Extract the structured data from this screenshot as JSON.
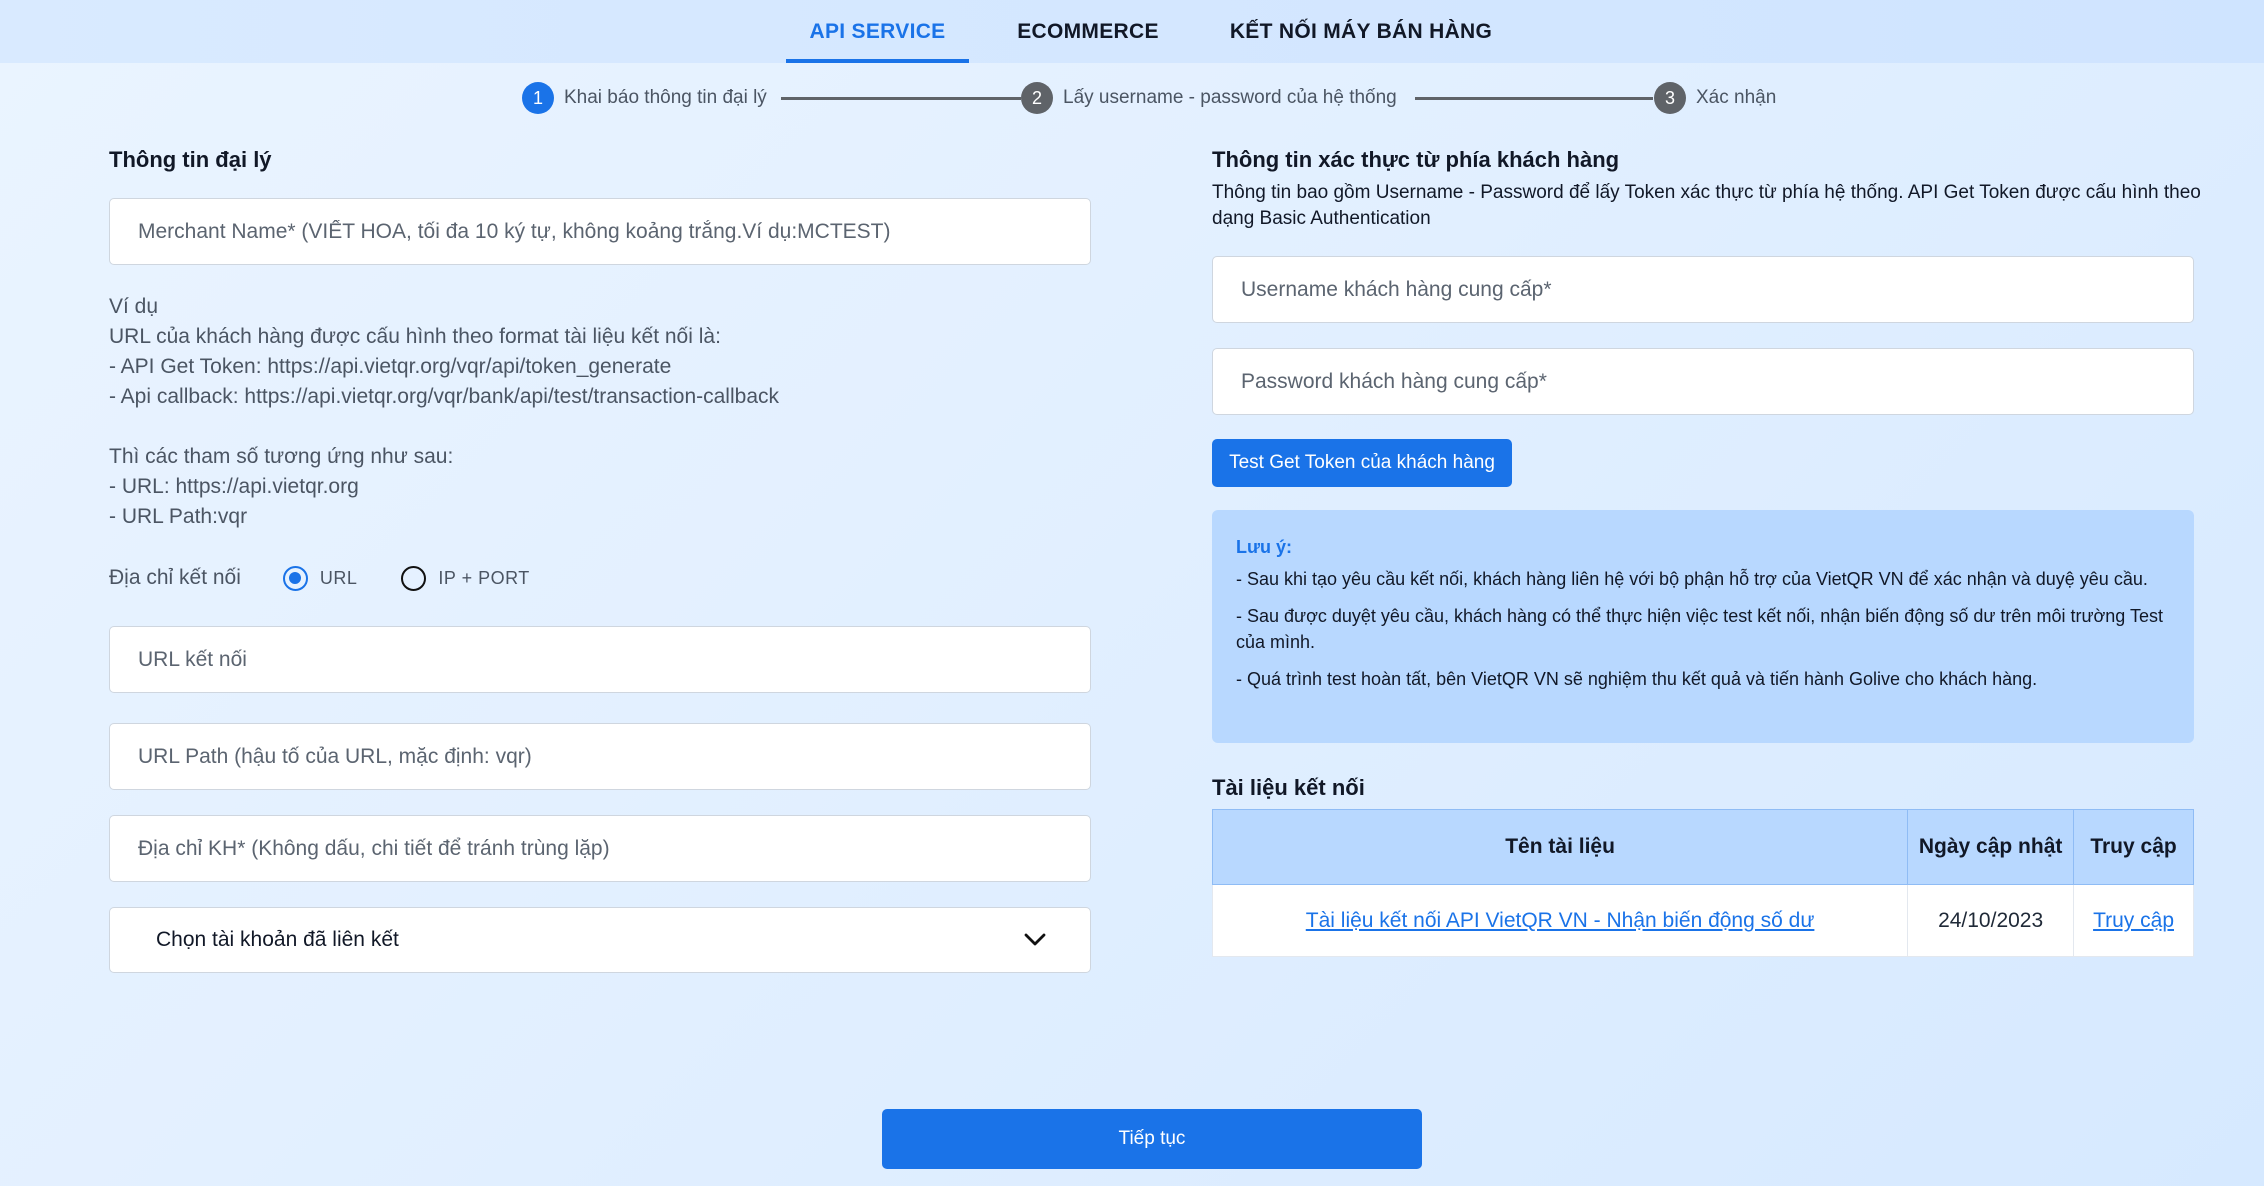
{
  "tabs": [
    "API SERVICE",
    "ECOMMERCE",
    "KẾT NỐI MÁY BÁN HÀNG"
  ],
  "steps": [
    {
      "number": "1",
      "label": "Khai báo thông tin đại lý"
    },
    {
      "number": "2",
      "label": "Lấy username - password của hệ thống"
    },
    {
      "number": "3",
      "label": "Xác nhận"
    }
  ],
  "left": {
    "title": "Thông tin đại lý",
    "merchant_placeholder": "Merchant Name* (VIẾT HOA, tối đa 10 ký tự, không koảng trắng.Ví dụ:MCTEST)",
    "example_lines": [
      "Ví dụ",
      "URL của khách hàng được cấu hình theo format tài liệu kết nối là:",
      "- API Get Token: https://api.vietqr.org/vqr/api/token_generate",
      "- Api callback: https://api.vietqr.org/vqr/bank/api/test/transaction-callback"
    ],
    "param_lines": [
      "Thì các tham số tương ứng như sau:",
      "- URL: https://api.vietqr.org",
      "- URL Path:vqr"
    ],
    "address_label": "Địa chỉ kết nối",
    "radio_url": "URL",
    "radio_ip": "IP + PORT",
    "url_placeholder": "URL kết nối",
    "url_path_placeholder": "URL Path (hậu tố của URL, mặc định: vqr)",
    "customer_address_placeholder": "Địa chỉ KH* (Không dấu, chi tiết để tránh trùng lặp)",
    "account_select": "Chọn tài khoản đã liên kết"
  },
  "right": {
    "title": "Thông tin xác thực từ phía khách hàng",
    "description": "Thông tin bao gồm Username - Password để lấy Token xác thực từ phía hệ thống. API Get Token được cấu hình theo dạng Basic Authentication",
    "username_placeholder": "Username khách hàng cung cấp*",
    "password_placeholder": "Password khách hàng cung cấp*",
    "test_button": "Test Get Token của khách hàng",
    "note_title": "Lưu ý:",
    "note_items": [
      "- Sau khi tạo yêu cầu kết nối, khách hàng liên hệ với bộ phận hỗ trợ của VietQR VN để xác nhận và duyệ yêu cầu.",
      "- Sau được duyệt yêu cầu, khách hàng có thể thực hiện việc test kết nối, nhận biến động số dư trên môi trường Test của mình.",
      "- Quá trình test hoàn tất, bên VietQR VN sẽ nghiệm thu kết quả và tiến hành Golive cho khách hàng."
    ],
    "docs_title": "Tài liệu kết nối",
    "table_headers": [
      "Tên tài liệu",
      "Ngày cập nhật",
      "Truy cập"
    ],
    "table_rows": [
      {
        "name": "Tài liệu kết nối API VietQR VN - Nhận biến động số dư",
        "date": "24/10/2023",
        "access": "Truy cập"
      }
    ]
  },
  "continue_button": "Tiếp tục",
  "colors": {
    "accent": "#1a73e8",
    "note_bg": "#b8d8ff",
    "step_inactive": "#5f6368"
  }
}
